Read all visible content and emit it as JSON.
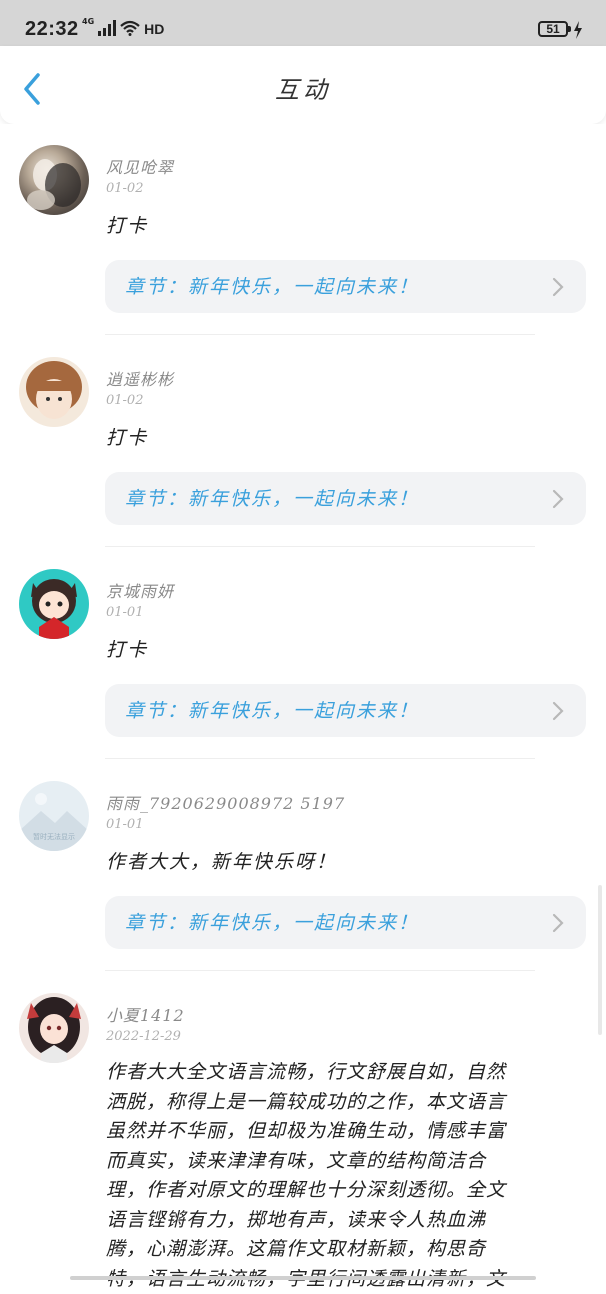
{
  "status_bar": {
    "time": "22:32",
    "network": "4G",
    "hd": "HD",
    "battery_percent": "51"
  },
  "header": {
    "title": "互动"
  },
  "comments": [
    {
      "user": "风见呛翠",
      "date": "01-02",
      "text": "打卡",
      "chapter": "章节：新年快乐，一起向未来！"
    },
    {
      "user": "逍遥彬彬",
      "date": "01-02",
      "text": "打卡",
      "chapter": "章节：新年快乐，一起向未来！"
    },
    {
      "user": "京城雨妍",
      "date": "01-01",
      "text": "打卡",
      "chapter": "章节：新年快乐，一起向未来！"
    },
    {
      "user": "雨雨_7920629008972 5197",
      "date": "01-01",
      "text": "作者大大，新年快乐呀！",
      "chapter": "章节：新年快乐，一起向未来！",
      "avatar_caption": "暂时无法显示"
    },
    {
      "user": "小夏1412",
      "date": "2022-12-29",
      "text_lines": [
        "作者大大全文语言流畅，行文舒展自如，自然",
        "洒脱，称得上是一篇较成功的之作，本文语言",
        "虽然并不华丽，但却极为准确生动，情感丰富",
        "而真实，读来津津有味，文章的结构简洁合",
        "理，作者对原文的理解也十分深刻透彻。全文",
        "语言铿锵有力，掷地有声，读来令人热血沸",
        "腾，心潮澎湃。这篇作文取材新颖，构思奇",
        "特，语言生动流畅，字里行间透露出清新，文"
      ]
    }
  ],
  "colors": {
    "accent": "#3aa0dc",
    "status_bar_bg": "#d6d6d6",
    "chapter_bg": "#f2f3f5"
  }
}
